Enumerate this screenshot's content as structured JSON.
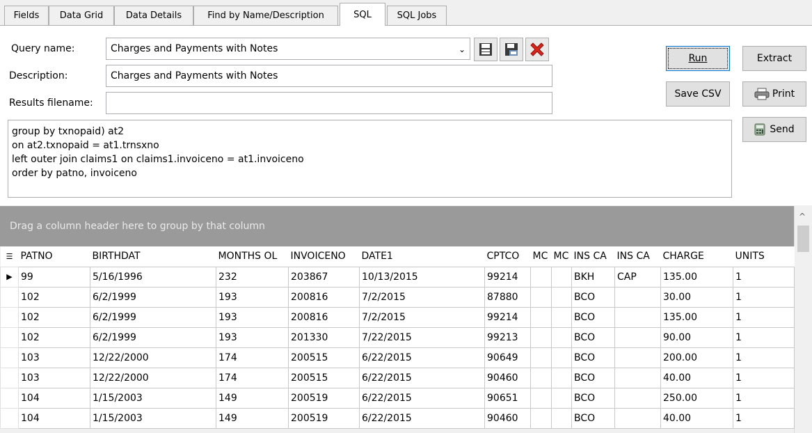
{
  "tabs": [
    {
      "label": "Fields"
    },
    {
      "label": "Data Grid"
    },
    {
      "label": "Data Details"
    },
    {
      "label": "Find by Name/Description"
    },
    {
      "label": "SQL"
    },
    {
      "label": "SQL Jobs"
    }
  ],
  "form": {
    "query_name_label": "Query name:",
    "query_name_value": "Charges and Payments with Notes",
    "description_label": "Description:",
    "description_value": "Charges and Payments with Notes",
    "results_filename_label": "Results filename:",
    "results_filename_value": "",
    "sql_text": "group by txnopaid) at2\non at2.txnopaid = at1.trnsxno\nleft outer join claims1 on claims1.invoiceno = at1.invoiceno\norder by patno, invoiceno"
  },
  "buttons": {
    "run": "Run",
    "extract": "Extract",
    "save_csv": "Save CSV",
    "print": "Print",
    "send": "Send"
  },
  "grid": {
    "group_hint": "Drag a column header here to group by that column",
    "columns": [
      "PATNO",
      "BIRTHDAT",
      "MONTHS OL",
      "INVOICENO",
      "DATE1",
      "CPTCO",
      "MC",
      "MC",
      "INS CA",
      "INS CA",
      "CHARGE",
      "UNITS"
    ],
    "rows": [
      [
        "99",
        "5/16/1996",
        "232",
        "203867",
        "10/13/2015",
        "99214",
        "",
        "",
        "BKH",
        "CAP",
        "135.00",
        "1"
      ],
      [
        "102",
        "6/2/1999",
        "193",
        "200816",
        "7/2/2015",
        "87880",
        "",
        "",
        "BCO",
        "",
        "30.00",
        "1"
      ],
      [
        "102",
        "6/2/1999",
        "193",
        "200816",
        "7/2/2015",
        "99214",
        "",
        "",
        "BCO",
        "",
        "135.00",
        "1"
      ],
      [
        "102",
        "6/2/1999",
        "193",
        "201330",
        "7/22/2015",
        "99213",
        "",
        "",
        "BCO",
        "",
        "90.00",
        "1"
      ],
      [
        "103",
        "12/22/2000",
        "174",
        "200515",
        "6/22/2015",
        "90649",
        "",
        "",
        "BCO",
        "",
        "200.00",
        "1"
      ],
      [
        "103",
        "12/22/2000",
        "174",
        "200515",
        "6/22/2015",
        "90460",
        "",
        "",
        "BCO",
        "",
        "40.00",
        "1"
      ],
      [
        "104",
        "1/15/2003",
        "149",
        "200519",
        "6/22/2015",
        "90651",
        "",
        "",
        "BCO",
        "",
        "250.00",
        "1"
      ],
      [
        "104",
        "1/15/2003",
        "149",
        "200519",
        "6/22/2015",
        "90460",
        "",
        "",
        "BCO",
        "",
        "40.00",
        "1"
      ]
    ]
  },
  "icons": {
    "save": "save-icon",
    "save_as": "save-as-icon",
    "delete": "delete-icon",
    "printer": "printer-icon",
    "calculator": "calculator-icon",
    "combo_arrow": "chevron-down-icon",
    "row_indicator": "current-row-icon",
    "column_chooser": "column-chooser-icon"
  },
  "colors": {
    "delete_red": "#d9261c",
    "group_bar": "#9a9a9a",
    "focus_blue": "#0078d7"
  }
}
